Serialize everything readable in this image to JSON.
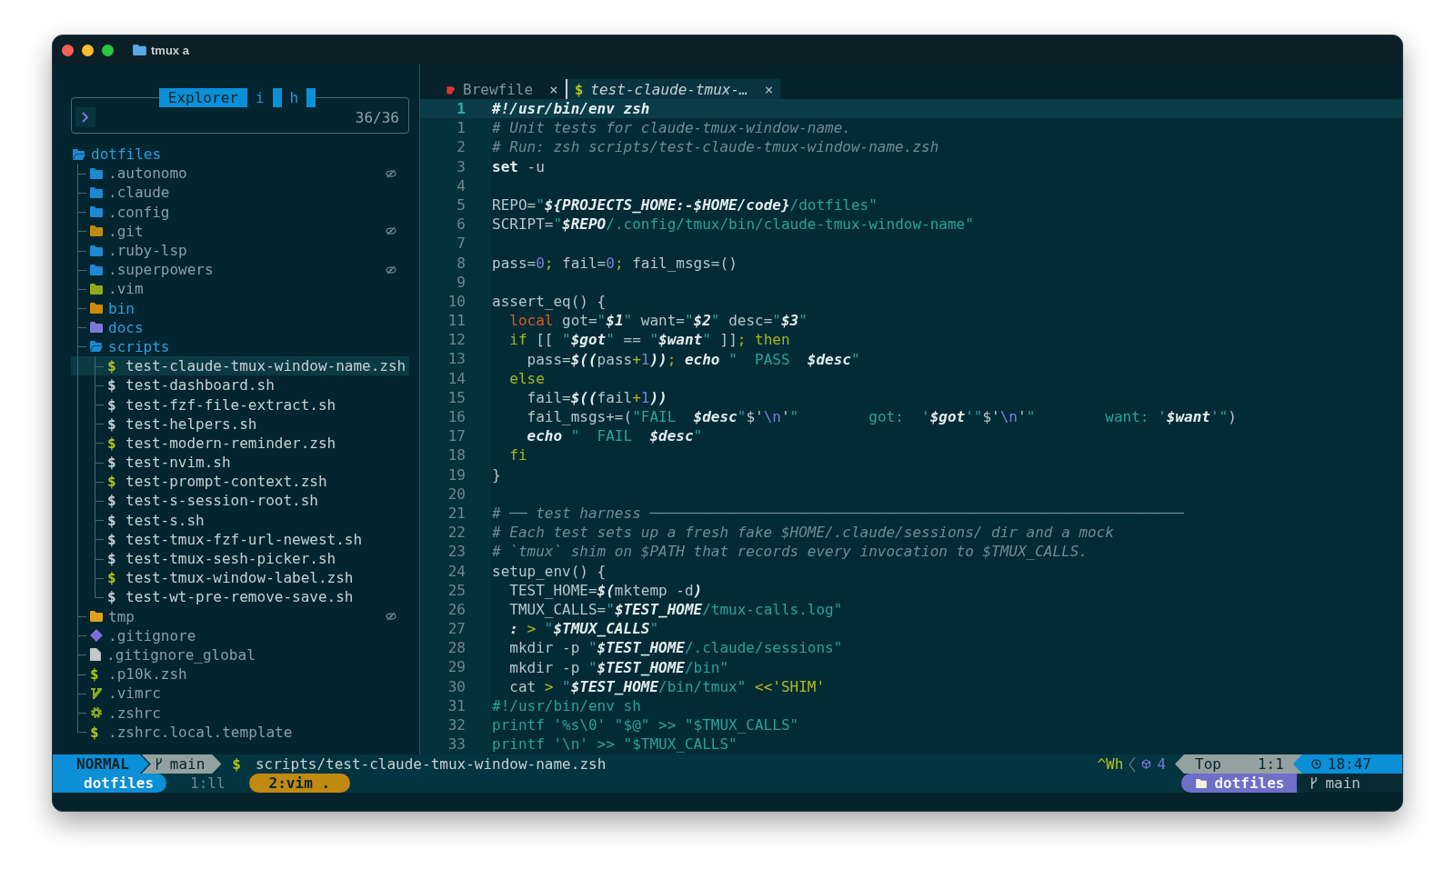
{
  "window": {
    "title": "tmux a"
  },
  "explorer": {
    "title": "Explorer",
    "toggles": [
      "i",
      "h"
    ],
    "count": "36/36",
    "tree": {
      "name": "dotfiles",
      "kind": "folder",
      "expanded": true,
      "hidden": false,
      "ignored": false,
      "selected": false,
      "color": "#1e88d0",
      "children": [
        {
          "name": ".autonomo",
          "kind": "folder",
          "expanded": false,
          "hidden": true,
          "ignored": true,
          "selected": false,
          "color": "#1e88d0"
        },
        {
          "name": ".claude",
          "kind": "folder",
          "expanded": false,
          "hidden": true,
          "ignored": false,
          "selected": false,
          "color": "#1e88d0"
        },
        {
          "name": ".config",
          "kind": "folder",
          "expanded": false,
          "hidden": true,
          "ignored": false,
          "selected": false,
          "color": "#1e88d0"
        },
        {
          "name": ".git",
          "kind": "folder",
          "expanded": false,
          "hidden": true,
          "ignored": true,
          "selected": false,
          "color": "#c08a10"
        },
        {
          "name": ".ruby-lsp",
          "kind": "folder",
          "expanded": false,
          "hidden": true,
          "ignored": false,
          "selected": false,
          "color": "#1e88d0"
        },
        {
          "name": ".superpowers",
          "kind": "folder",
          "expanded": false,
          "hidden": true,
          "ignored": true,
          "selected": false,
          "color": "#1e88d0"
        },
        {
          "name": ".vim",
          "kind": "folder",
          "expanded": false,
          "hidden": true,
          "ignored": false,
          "selected": false,
          "color": "#8faa1f"
        },
        {
          "name": "bin",
          "kind": "folder",
          "expanded": false,
          "hidden": false,
          "ignored": false,
          "selected": false,
          "color": "#d08a0a"
        },
        {
          "name": "docs",
          "kind": "folder",
          "expanded": false,
          "hidden": false,
          "ignored": false,
          "selected": false,
          "color": "#7c78d8"
        },
        {
          "name": "scripts",
          "kind": "folder",
          "expanded": true,
          "hidden": false,
          "ignored": false,
          "selected": false,
          "color": "#1e88d0",
          "children": [
            {
              "name": "test-claude-tmux-window-name.zsh",
              "kind": "script",
              "glyph": "$",
              "hidden": false,
              "ignored": false,
              "selected": true,
              "color": "#b5c21a"
            },
            {
              "name": "test-dashboard.sh",
              "kind": "script",
              "glyph": "$",
              "hidden": false,
              "ignored": false,
              "selected": false,
              "color": "#c5d0d3"
            },
            {
              "name": "test-fzf-file-extract.sh",
              "kind": "script",
              "glyph": "$",
              "hidden": false,
              "ignored": false,
              "selected": false,
              "color": "#c5d0d3"
            },
            {
              "name": "test-helpers.sh",
              "kind": "script",
              "glyph": "$",
              "hidden": false,
              "ignored": false,
              "selected": false,
              "color": "#c5d0d3"
            },
            {
              "name": "test-modern-reminder.zsh",
              "kind": "script",
              "glyph": "$",
              "hidden": false,
              "ignored": false,
              "selected": false,
              "color": "#b5c21a"
            },
            {
              "name": "test-nvim.sh",
              "kind": "script",
              "glyph": "$",
              "hidden": false,
              "ignored": false,
              "selected": false,
              "color": "#c5d0d3"
            },
            {
              "name": "test-prompt-context.zsh",
              "kind": "script",
              "glyph": "$",
              "hidden": false,
              "ignored": false,
              "selected": false,
              "color": "#b5c21a"
            },
            {
              "name": "test-s-session-root.sh",
              "kind": "script",
              "glyph": "$",
              "hidden": false,
              "ignored": false,
              "selected": false,
              "color": "#c5d0d3"
            },
            {
              "name": "test-s.sh",
              "kind": "script",
              "glyph": "$",
              "hidden": false,
              "ignored": false,
              "selected": false,
              "color": "#c5d0d3"
            },
            {
              "name": "test-tmux-fzf-url-newest.sh",
              "kind": "script",
              "glyph": "$",
              "hidden": false,
              "ignored": false,
              "selected": false,
              "color": "#c5d0d3"
            },
            {
              "name": "test-tmux-sesh-picker.sh",
              "kind": "script",
              "glyph": "$",
              "hidden": false,
              "ignored": false,
              "selected": false,
              "color": "#c5d0d3"
            },
            {
              "name": "test-tmux-window-label.zsh",
              "kind": "script",
              "glyph": "$",
              "hidden": false,
              "ignored": false,
              "selected": false,
              "color": "#b5c21a"
            },
            {
              "name": "test-wt-pre-remove-save.sh",
              "kind": "script",
              "glyph": "$",
              "hidden": false,
              "ignored": false,
              "selected": false,
              "color": "#c5d0d3"
            }
          ]
        },
        {
          "name": "tmp",
          "kind": "folder",
          "expanded": false,
          "hidden": true,
          "ignored": true,
          "selected": false,
          "color": "#e0a020"
        },
        {
          "name": ".gitignore",
          "kind": "git",
          "hidden": true,
          "ignored": false,
          "selected": false,
          "color": "#7c6cd8"
        },
        {
          "name": ".gitignore_global",
          "kind": "doc",
          "hidden": true,
          "ignored": false,
          "selected": false,
          "color": "#c0c8cc"
        },
        {
          "name": ".p10k.zsh",
          "kind": "script",
          "glyph": "$",
          "hidden": true,
          "ignored": false,
          "selected": false,
          "color": "#b5c21a"
        },
        {
          "name": ".vimrc",
          "kind": "vim",
          "hidden": true,
          "ignored": false,
          "selected": false,
          "color": "#8faa1f"
        },
        {
          "name": ".zshrc",
          "kind": "gear",
          "hidden": true,
          "ignored": false,
          "selected": false,
          "color": "#8faa1f"
        },
        {
          "name": ".zshrc.local.template",
          "kind": "script",
          "glyph": "$",
          "hidden": true,
          "ignored": false,
          "selected": false,
          "color": "#b5c21a"
        }
      ]
    }
  },
  "tabs": [
    {
      "label": "Brewfile",
      "kind": "brew",
      "close": "×",
      "selected": false
    },
    {
      "label": "test-claude-tmux-…",
      "kind": "script",
      "glyph": "$",
      "close": "×",
      "selected": true
    }
  ],
  "code": [
    {
      "num": "1",
      "current": true,
      "tokens": [
        {
          "text": "#!/usr/bin/env zsh",
          "kind": "shebang"
        }
      ]
    },
    {
      "num": "1",
      "current": false,
      "tokens": [
        {
          "text": "# Unit tests for claude-tmux-window-name.",
          "kind": "comment"
        }
      ]
    },
    {
      "num": "2",
      "current": false,
      "tokens": [
        {
          "text": "# Run: zsh scripts/test-claude-tmux-window-name.zsh",
          "kind": "comment"
        }
      ]
    },
    {
      "num": "3",
      "current": false,
      "tokens": [
        {
          "text": "set",
          "kind": "bold"
        },
        {
          "text": " -u",
          "kind": "plain"
        }
      ]
    },
    {
      "num": "4",
      "current": false
    },
    {
      "num": "5",
      "current": false,
      "tokens": [
        {
          "text": "REPO=",
          "kind": "plain"
        },
        {
          "text": "\"",
          "kind": "str"
        },
        {
          "text": "${PROJECTS_HOME:-$HOME/code}",
          "kind": "var"
        },
        {
          "text": "/dotfiles\"",
          "kind": "str"
        }
      ]
    },
    {
      "num": "6",
      "current": false,
      "tokens": [
        {
          "text": "SCRIPT=",
          "kind": "plain"
        },
        {
          "text": "\"",
          "kind": "str"
        },
        {
          "text": "$REPO",
          "kind": "var"
        },
        {
          "text": "/.config/tmux/bin/claude-tmux-window-name\"",
          "kind": "str"
        }
      ]
    },
    {
      "num": "7",
      "current": false
    },
    {
      "num": "8",
      "current": false,
      "tokens": [
        {
          "text": "pass=",
          "kind": "plain"
        },
        {
          "text": "0",
          "kind": "num"
        },
        {
          "text": ";",
          "kind": "op"
        },
        {
          "text": " fail=",
          "kind": "plain"
        },
        {
          "text": "0",
          "kind": "num"
        },
        {
          "text": ";",
          "kind": "op"
        },
        {
          "text": " fail_msgs=()",
          "kind": "plain"
        }
      ]
    },
    {
      "num": "9",
      "current": false
    },
    {
      "num": "10",
      "current": false,
      "tokens": [
        {
          "text": "assert_eq() {",
          "kind": "plain"
        }
      ]
    },
    {
      "num": "11",
      "current": false,
      "tokens": [
        {
          "text": "  local",
          "kind": "local"
        },
        {
          "text": " got=",
          "kind": "plain"
        },
        {
          "text": "\"",
          "kind": "str"
        },
        {
          "text": "$1",
          "kind": "var"
        },
        {
          "text": "\"",
          "kind": "str"
        },
        {
          "text": " want=",
          "kind": "plain"
        },
        {
          "text": "\"",
          "kind": "str"
        },
        {
          "text": "$2",
          "kind": "var"
        },
        {
          "text": "\"",
          "kind": "str"
        },
        {
          "text": " desc=",
          "kind": "plain"
        },
        {
          "text": "\"",
          "kind": "str"
        },
        {
          "text": "$3",
          "kind": "var"
        },
        {
          "text": "\"",
          "kind": "str"
        }
      ]
    },
    {
      "num": "12",
      "current": false,
      "tokens": [
        {
          "text": "  if",
          "kind": "kw"
        },
        {
          "text": " [[ ",
          "kind": "plain"
        },
        {
          "text": "\"",
          "kind": "str"
        },
        {
          "text": "$got",
          "kind": "var"
        },
        {
          "text": "\"",
          "kind": "str"
        },
        {
          "text": " == ",
          "kind": "plain"
        },
        {
          "text": "\"",
          "kind": "str"
        },
        {
          "text": "$want",
          "kind": "var"
        },
        {
          "text": "\"",
          "kind": "str"
        },
        {
          "text": " ]]",
          "kind": "plain"
        },
        {
          "text": ";",
          "kind": "op"
        },
        {
          "text": " then",
          "kind": "kw"
        }
      ]
    },
    {
      "num": "13",
      "current": false,
      "tokens": [
        {
          "text": "    pass=",
          "kind": "plain"
        },
        {
          "text": "$((",
          "kind": "var"
        },
        {
          "text": "pass",
          "kind": "plain"
        },
        {
          "text": "+",
          "kind": "op"
        },
        {
          "text": "1",
          "kind": "num"
        },
        {
          "text": "))",
          "kind": "var"
        },
        {
          "text": ";",
          "kind": "op"
        },
        {
          "text": " echo",
          "kind": "boldi"
        },
        {
          "text": " \"  PASS  ",
          "kind": "str"
        },
        {
          "text": "$desc",
          "kind": "var"
        },
        {
          "text": "\"",
          "kind": "str"
        }
      ]
    },
    {
      "num": "14",
      "current": false,
      "tokens": [
        {
          "text": "  else",
          "kind": "kw"
        }
      ]
    },
    {
      "num": "15",
      "current": false,
      "tokens": [
        {
          "text": "    fail=",
          "kind": "plain"
        },
        {
          "text": "$((",
          "kind": "var"
        },
        {
          "text": "fail",
          "kind": "plain"
        },
        {
          "text": "+",
          "kind": "op"
        },
        {
          "text": "1",
          "kind": "num"
        },
        {
          "text": "))",
          "kind": "var"
        }
      ]
    },
    {
      "num": "16",
      "current": false,
      "tokens": [
        {
          "text": "    fail_msgs+=(",
          "kind": "plain"
        },
        {
          "text": "\"FAIL  ",
          "kind": "str"
        },
        {
          "text": "$desc",
          "kind": "var"
        },
        {
          "text": "\"",
          "kind": "str"
        },
        {
          "text": "$'",
          "kind": "plain"
        },
        {
          "text": "\\n",
          "kind": "num"
        },
        {
          "text": "'",
          "kind": "plain"
        },
        {
          "text": "\"        got:  '",
          "kind": "str"
        },
        {
          "text": "$got",
          "kind": "var"
        },
        {
          "text": "'\"",
          "kind": "str"
        },
        {
          "text": "$'",
          "kind": "plain"
        },
        {
          "text": "\\n",
          "kind": "num"
        },
        {
          "text": "'",
          "kind": "plain"
        },
        {
          "text": "\"        want: '",
          "kind": "str"
        },
        {
          "text": "$want",
          "kind": "var"
        },
        {
          "text": "'\"",
          "kind": "str"
        },
        {
          "text": ")",
          "kind": "plain"
        }
      ]
    },
    {
      "num": "17",
      "current": false,
      "tokens": [
        {
          "text": "    echo",
          "kind": "boldi"
        },
        {
          "text": " \"  FAIL  ",
          "kind": "str"
        },
        {
          "text": "$desc",
          "kind": "var"
        },
        {
          "text": "\"",
          "kind": "str"
        }
      ]
    },
    {
      "num": "18",
      "current": false,
      "tokens": [
        {
          "text": "  fi",
          "kind": "kw"
        }
      ]
    },
    {
      "num": "19",
      "current": false,
      "tokens": [
        {
          "text": "}",
          "kind": "plain"
        }
      ]
    },
    {
      "num": "20",
      "current": false
    },
    {
      "num": "21",
      "current": false,
      "tokens": [
        {
          "text": "# ── test harness ─────────────────────────────────────────────────────────────",
          "kind": "comment"
        }
      ]
    },
    {
      "num": "22",
      "current": false,
      "tokens": [
        {
          "text": "# Each test sets up a fresh fake $HOME/.claude/sessions/ dir and a mock",
          "kind": "comment"
        }
      ]
    },
    {
      "num": "23",
      "current": false,
      "tokens": [
        {
          "text": "# `tmux` shim on $PATH that records every invocation to $TMUX_CALLS.",
          "kind": "comment"
        }
      ]
    },
    {
      "num": "24",
      "current": false,
      "tokens": [
        {
          "text": "setup_env() {",
          "kind": "plain"
        }
      ]
    },
    {
      "num": "25",
      "current": false,
      "tokens": [
        {
          "text": "  TEST_HOME=",
          "kind": "plain"
        },
        {
          "text": "$(",
          "kind": "var"
        },
        {
          "text": "mktemp -d",
          "kind": "plain"
        },
        {
          "text": ")",
          "kind": "var"
        }
      ]
    },
    {
      "num": "26",
      "current": false,
      "tokens": [
        {
          "text": "  TMUX_CALLS=",
          "kind": "plain"
        },
        {
          "text": "\"",
          "kind": "str"
        },
        {
          "text": "$TEST_HOME",
          "kind": "var"
        },
        {
          "text": "/tmux-calls.log\"",
          "kind": "str"
        }
      ]
    },
    {
      "num": "27",
      "current": false,
      "tokens": [
        {
          "text": "  :",
          "kind": "var"
        },
        {
          "text": " >",
          "kind": "op"
        },
        {
          "text": " \"",
          "kind": "str"
        },
        {
          "text": "$TMUX_CALLS",
          "kind": "var"
        },
        {
          "text": "\"",
          "kind": "str"
        }
      ]
    },
    {
      "num": "28",
      "current": false,
      "tokens": [
        {
          "text": "  mkdir -p ",
          "kind": "plain"
        },
        {
          "text": "\"",
          "kind": "str"
        },
        {
          "text": "$TEST_HOME",
          "kind": "var"
        },
        {
          "text": "/.claude/sessions\"",
          "kind": "str"
        }
      ]
    },
    {
      "num": "29",
      "current": false,
      "tokens": [
        {
          "text": "  mkdir -p ",
          "kind": "plain"
        },
        {
          "text": "\"",
          "kind": "str"
        },
        {
          "text": "$TEST_HOME",
          "kind": "var"
        },
        {
          "text": "/bin\"",
          "kind": "str"
        }
      ]
    },
    {
      "num": "30",
      "current": false,
      "tokens": [
        {
          "text": "  cat ",
          "kind": "plain"
        },
        {
          "text": ">",
          "kind": "op"
        },
        {
          "text": " \"",
          "kind": "str"
        },
        {
          "text": "$TEST_HOME",
          "kind": "var"
        },
        {
          "text": "/bin/tmux\"",
          "kind": "str"
        },
        {
          "text": " <<'SHIM'",
          "kind": "op"
        }
      ]
    },
    {
      "num": "31",
      "current": false,
      "tokens": [
        {
          "text": "#!/usr/bin/env sh",
          "kind": "str"
        }
      ]
    },
    {
      "num": "32",
      "current": false,
      "tokens": [
        {
          "text": "printf '%s\\0' \"$@\" >> \"$TMUX_CALLS\"",
          "kind": "str"
        }
      ]
    },
    {
      "num": "33",
      "current": false,
      "tokens": [
        {
          "text": "printf '\\n' >> \"$TMUX_CALLS\"",
          "kind": "str"
        }
      ]
    }
  ],
  "statusline": {
    "mode": "NORMAL",
    "branch": "main",
    "file_glyph": "$",
    "path": "scripts/test-claude-tmux-window-name.zsh",
    "keys": "^Wh",
    "diagnostics": "4",
    "scroll": "Top",
    "cursor": "1:1",
    "time": "18:47"
  },
  "tmux": {
    "session": "dotfiles",
    "windows": [
      {
        "label": "1:ll",
        "selected": false
      },
      {
        "label": "2:vim .",
        "selected": true
      }
    ],
    "folder": "dotfiles",
    "branch": "main"
  }
}
